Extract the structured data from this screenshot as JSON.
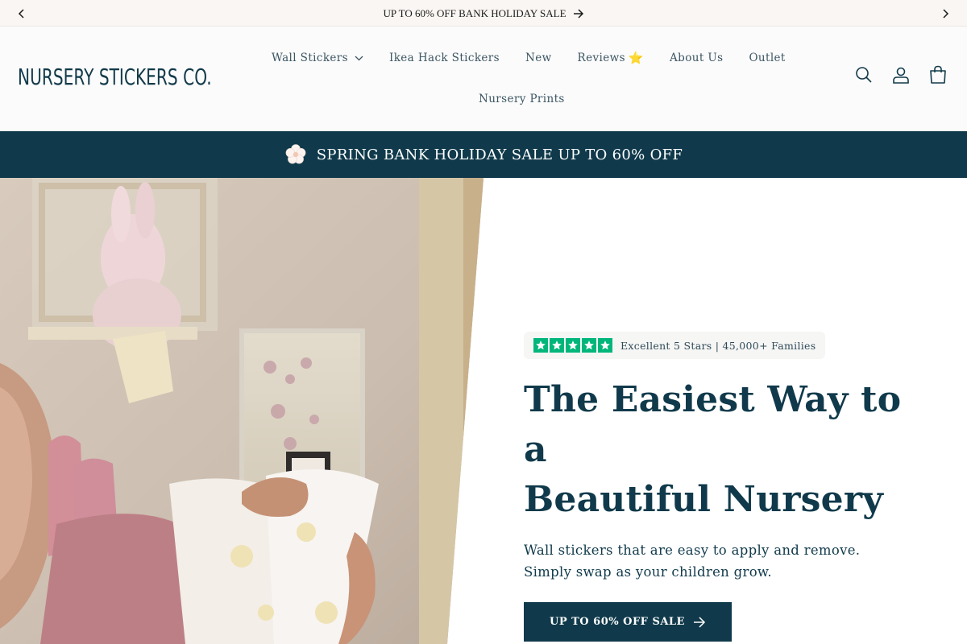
{
  "announcement": {
    "text": "UP TO 60% OFF BANK HOLIDAY SALE",
    "prev_icon": "chevron-left-icon",
    "next_icon": "chevron-right-icon",
    "link_icon": "arrow-right-icon"
  },
  "header": {
    "logo": "NURSERY STICKERS CO.",
    "nav": [
      {
        "label": "Wall Stickers",
        "has_dropdown": true
      },
      {
        "label": "Ikea Hack Stickers"
      },
      {
        "label": "New"
      },
      {
        "label": "Reviews",
        "icon": "star-icon",
        "icon_glyph": "⭐"
      },
      {
        "label": "About Us"
      },
      {
        "label": "Outlet"
      },
      {
        "label": "Nursery Prints"
      }
    ],
    "icons": [
      "search-icon",
      "account-icon",
      "cart-icon"
    ]
  },
  "promo": {
    "text": "SPRING BANK HOLIDAY SALE UP TO 60% OFF",
    "icon": "flower-icon"
  },
  "hero": {
    "rating_text": "Excellent 5 Stars | 45,000+ Families",
    "rating_stars": 5,
    "title_line1": "The Easiest Way to a",
    "title_line2": "Beautiful Nursery",
    "subtitle": "Wall stickers that are easy to apply and remove. Simply swap as your children grow.",
    "cta_label": "UP TO 60% OFF SALE"
  },
  "colors": {
    "brand_dark": "#103a4b",
    "announce_bg": "#faf6f3",
    "trustpilot_green": "#00b67a"
  }
}
